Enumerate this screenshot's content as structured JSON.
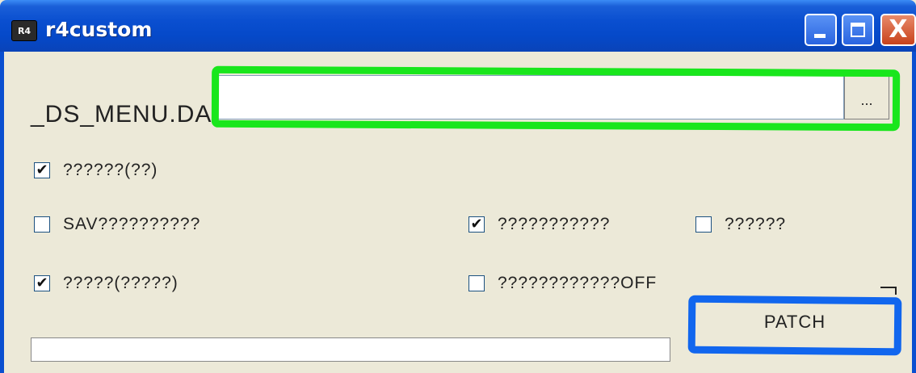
{
  "window": {
    "title": "r4custom",
    "icon_text": "R4",
    "icon": "app-icon",
    "controls": [
      "minimize-icon",
      "maximize-icon",
      "close-icon"
    ],
    "close_glyph": "X"
  },
  "file": {
    "label": "_DS_MENU.DA",
    "path_value": "",
    "browse_label": "..."
  },
  "options": [
    {
      "label": "??????(??)",
      "checked": true
    },
    {
      "label": "SAV??????????",
      "checked": false
    },
    {
      "label": "???????????",
      "checked": true
    },
    {
      "label": "??????",
      "checked": false
    },
    {
      "label": "?????(?????)",
      "checked": true
    },
    {
      "label": "????????????OFF",
      "checked": false
    }
  ],
  "check_glyph": "✔",
  "actions": {
    "patch_label": "PATCH"
  },
  "annotations": {
    "green_color": "#19e61c",
    "blue_color": "#1166ee"
  }
}
